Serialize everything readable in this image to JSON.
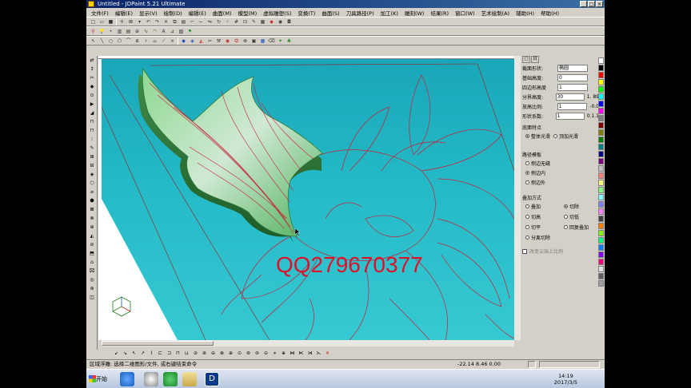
{
  "window": {
    "title": "Untitled - JDPaint 5.21 Ultimate",
    "buttons": [
      "_",
      "□",
      "×"
    ]
  },
  "menu": [
    "文件(F)",
    "编辑(E)",
    "显示(V)",
    "绘制(D)",
    "编辑(E)",
    "曲面(M)",
    "模型(M)",
    "虚拟雕塑(S)",
    "变换(T)",
    "曲面(S)",
    "刀具路径(P)",
    "加工(K)",
    "雕刻(W)",
    "结果(R)",
    "窗口(W)",
    "艺术绘制(A)",
    "辅助(H)",
    "帮助(H)"
  ],
  "viewport": {
    "watermark": "QQ279670377",
    "colors": {
      "bg_top": "#1aa6b8",
      "bg_bottom": "#35c9d2",
      "curve": "#d8203a",
      "relief": "#5fbf6a",
      "relief_dark": "#2f7a3a",
      "white": "#ffffff"
    }
  },
  "right_panel": {
    "tab_labels": [
      "□",
      "日"
    ],
    "rows": [
      {
        "label": "截面形状:",
        "value": "椭圆"
      },
      {
        "label": "基础高度:",
        "value": "0"
      },
      {
        "label": "四边形高度",
        "value": "1"
      },
      {
        "label": "分界高度:",
        "value": "30",
        "extra": "1. 89"
      },
      {
        "label": "放高比例:",
        "value": "1",
        "extra": "-0.0"
      },
      {
        "label": "形状系数:",
        "value": "1",
        "extra": "0.1.1"
      }
    ],
    "bottom_type": {
      "title": "底面特点",
      "options": [
        "整体光滑",
        "顶加光滑"
      ],
      "selected": 0
    },
    "outline": {
      "title": "路径模板",
      "options": [
        "侧边无缝",
        "侧边内",
        "侧边外"
      ],
      "selected": 1
    },
    "mode": {
      "title": "叠加方式",
      "options": [
        "叠加",
        "切除",
        "切高",
        "切低",
        "切平",
        "回复叠加",
        "分离切除"
      ],
      "selected": 1
    },
    "checkbox": "改变尖端上比例"
  },
  "status": {
    "prompt": "区域浮雕: 选择二维图形/文件, 或右键结束命令",
    "coords": "-22.14 8.46 0.00"
  },
  "taskbar": {
    "start": "开始",
    "time": "14:19",
    "date": "2017/3/5"
  },
  "palette": [
    "#ffffff",
    "#000000",
    "#ff0000",
    "#ffff00",
    "#00ff00",
    "#00ffff",
    "#0000ff",
    "#ff00ff",
    "#808080",
    "#800000",
    "#808000",
    "#008000",
    "#008080",
    "#000080",
    "#800080",
    "#c0c0c0",
    "#ff8080",
    "#ffff80",
    "#80ff80",
    "#80ffff",
    "#8080ff",
    "#ff80ff",
    "#404040",
    "#ff8000",
    "#80ff00",
    "#00ff80",
    "#0080ff",
    "#8000ff",
    "#ff0080",
    "#e0e0e0",
    "#606060",
    "#a0a0a0"
  ]
}
